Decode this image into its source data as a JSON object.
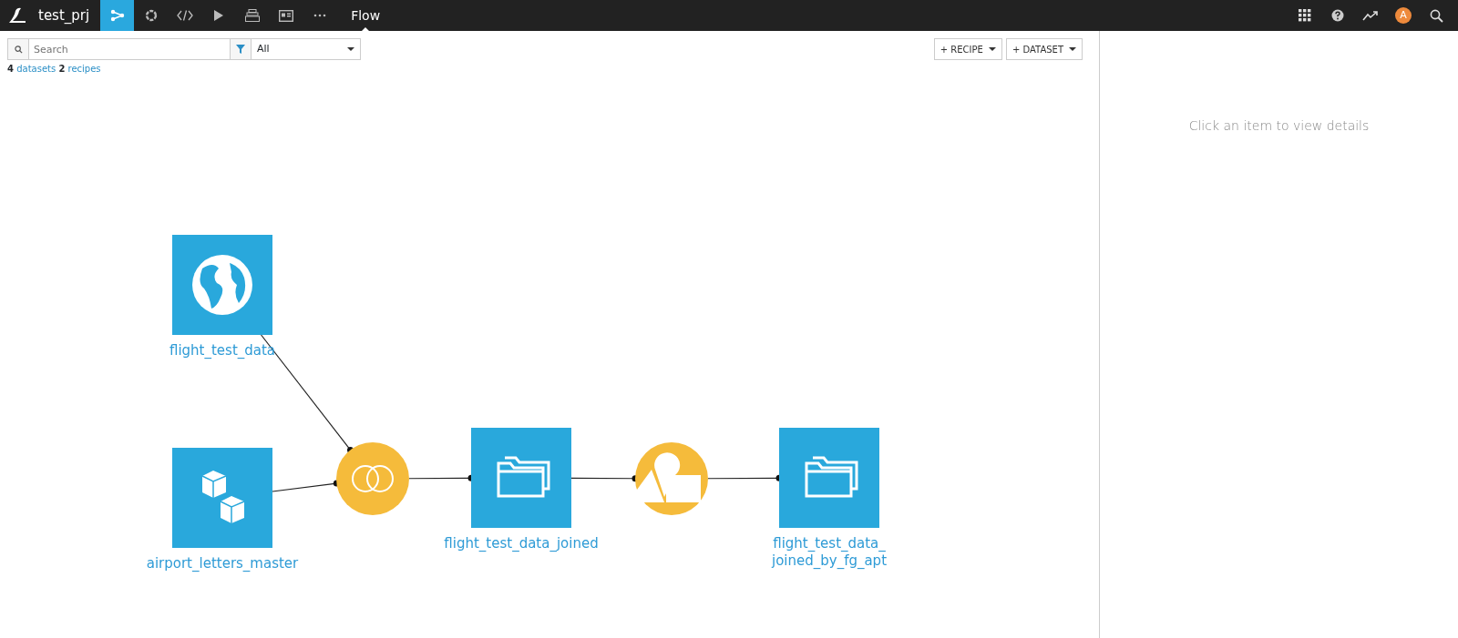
{
  "topbar": {
    "project": "test_prj",
    "nav_icons": [
      {
        "selected": true
      },
      {
        "selected": false
      },
      {
        "selected": false
      },
      {
        "selected": false
      },
      {
        "selected": false
      },
      {
        "selected": false
      },
      {
        "selected": false
      }
    ],
    "section": "Flow",
    "avatar": "A"
  },
  "toolbar": {
    "search": {
      "placeholder": "Search"
    },
    "filter": {
      "value": "All"
    },
    "buttons": [
      "+ RECIPE",
      "+ DATASET"
    ]
  },
  "summary": {
    "datasets_count": "4",
    "datasets_label": "datasets",
    "recipes_count": "2",
    "recipes_label": "recipes"
  },
  "flow": {
    "nodes": [
      {
        "kind": "dataset",
        "label": "flight_test_data"
      },
      {
        "kind": "dataset",
        "label": "airport_letters_master"
      },
      {
        "kind": "recipe"
      },
      {
        "kind": "dataset",
        "label": "flight_test_data_joined"
      },
      {
        "kind": "recipe"
      },
      {
        "kind": "dataset",
        "label": "flight_test_data_\njoined_by_fg_apt"
      }
    ]
  },
  "details_panel": {
    "message": "Click an item to view details"
  }
}
